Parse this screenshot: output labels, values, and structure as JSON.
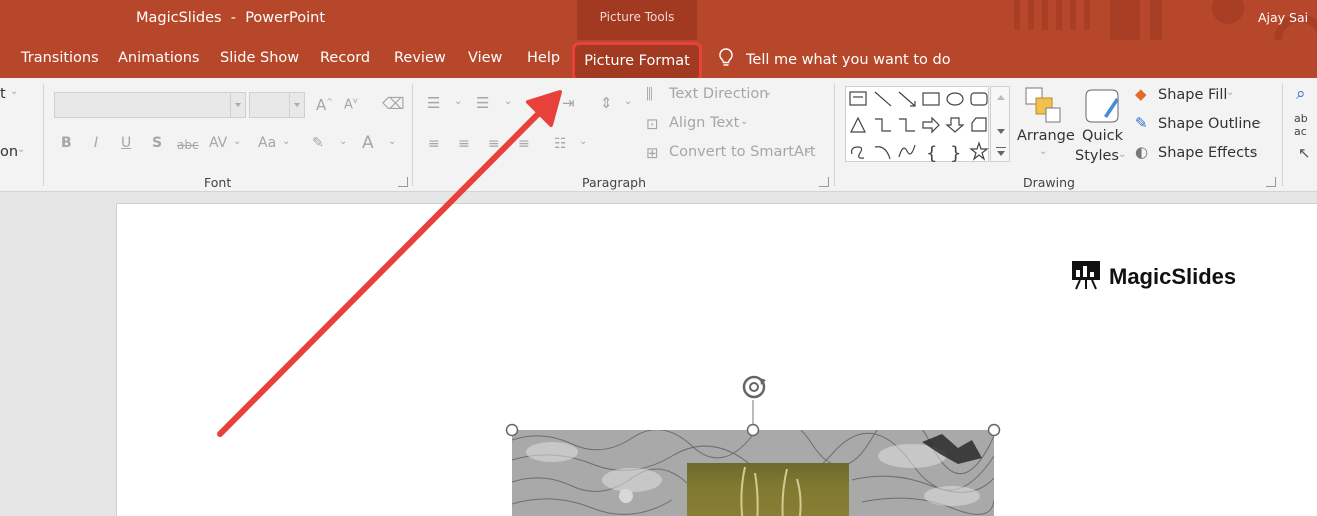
{
  "window": {
    "title": "MagicSlides  -  PowerPoint",
    "context_group": "Picture Tools",
    "user": "Ajay Sai"
  },
  "tabs": [
    {
      "label": "Transitions"
    },
    {
      "label": "Animations"
    },
    {
      "label": "Slide Show"
    },
    {
      "label": "Record"
    },
    {
      "label": "Review"
    },
    {
      "label": "View"
    },
    {
      "label": "Help"
    }
  ],
  "active_tab": {
    "label": "Picture Format",
    "highlighted": true,
    "highlight_color": "#e8403b"
  },
  "tell_me": "Tell me what you want to do",
  "ribbon": {
    "left_partial": {
      "top": "t",
      "bottom": "on"
    },
    "font_group": {
      "label": "Font",
      "buttons": [
        "B",
        "I",
        "U",
        "S",
        "abc",
        "AV",
        "Aa",
        "A"
      ]
    },
    "paragraph_group": {
      "label": "Paragraph",
      "text_direction": "Text Direction",
      "align_text": "Align Text",
      "convert_smartart": "Convert to SmartArt"
    },
    "drawing_group": {
      "label": "Drawing",
      "arrange": "Arrange",
      "quick_styles_line1": "Quick",
      "quick_styles_line2": "Styles",
      "shape_fill": "Shape Fill",
      "shape_outline": "Shape Outline",
      "shape_effects": "Shape Effects"
    }
  },
  "slide": {
    "brand": "MagicSlides"
  },
  "colors": {
    "ribbon_red": "#b7472a",
    "context_red": "#a13a21",
    "annotation_red": "#e8403b"
  }
}
